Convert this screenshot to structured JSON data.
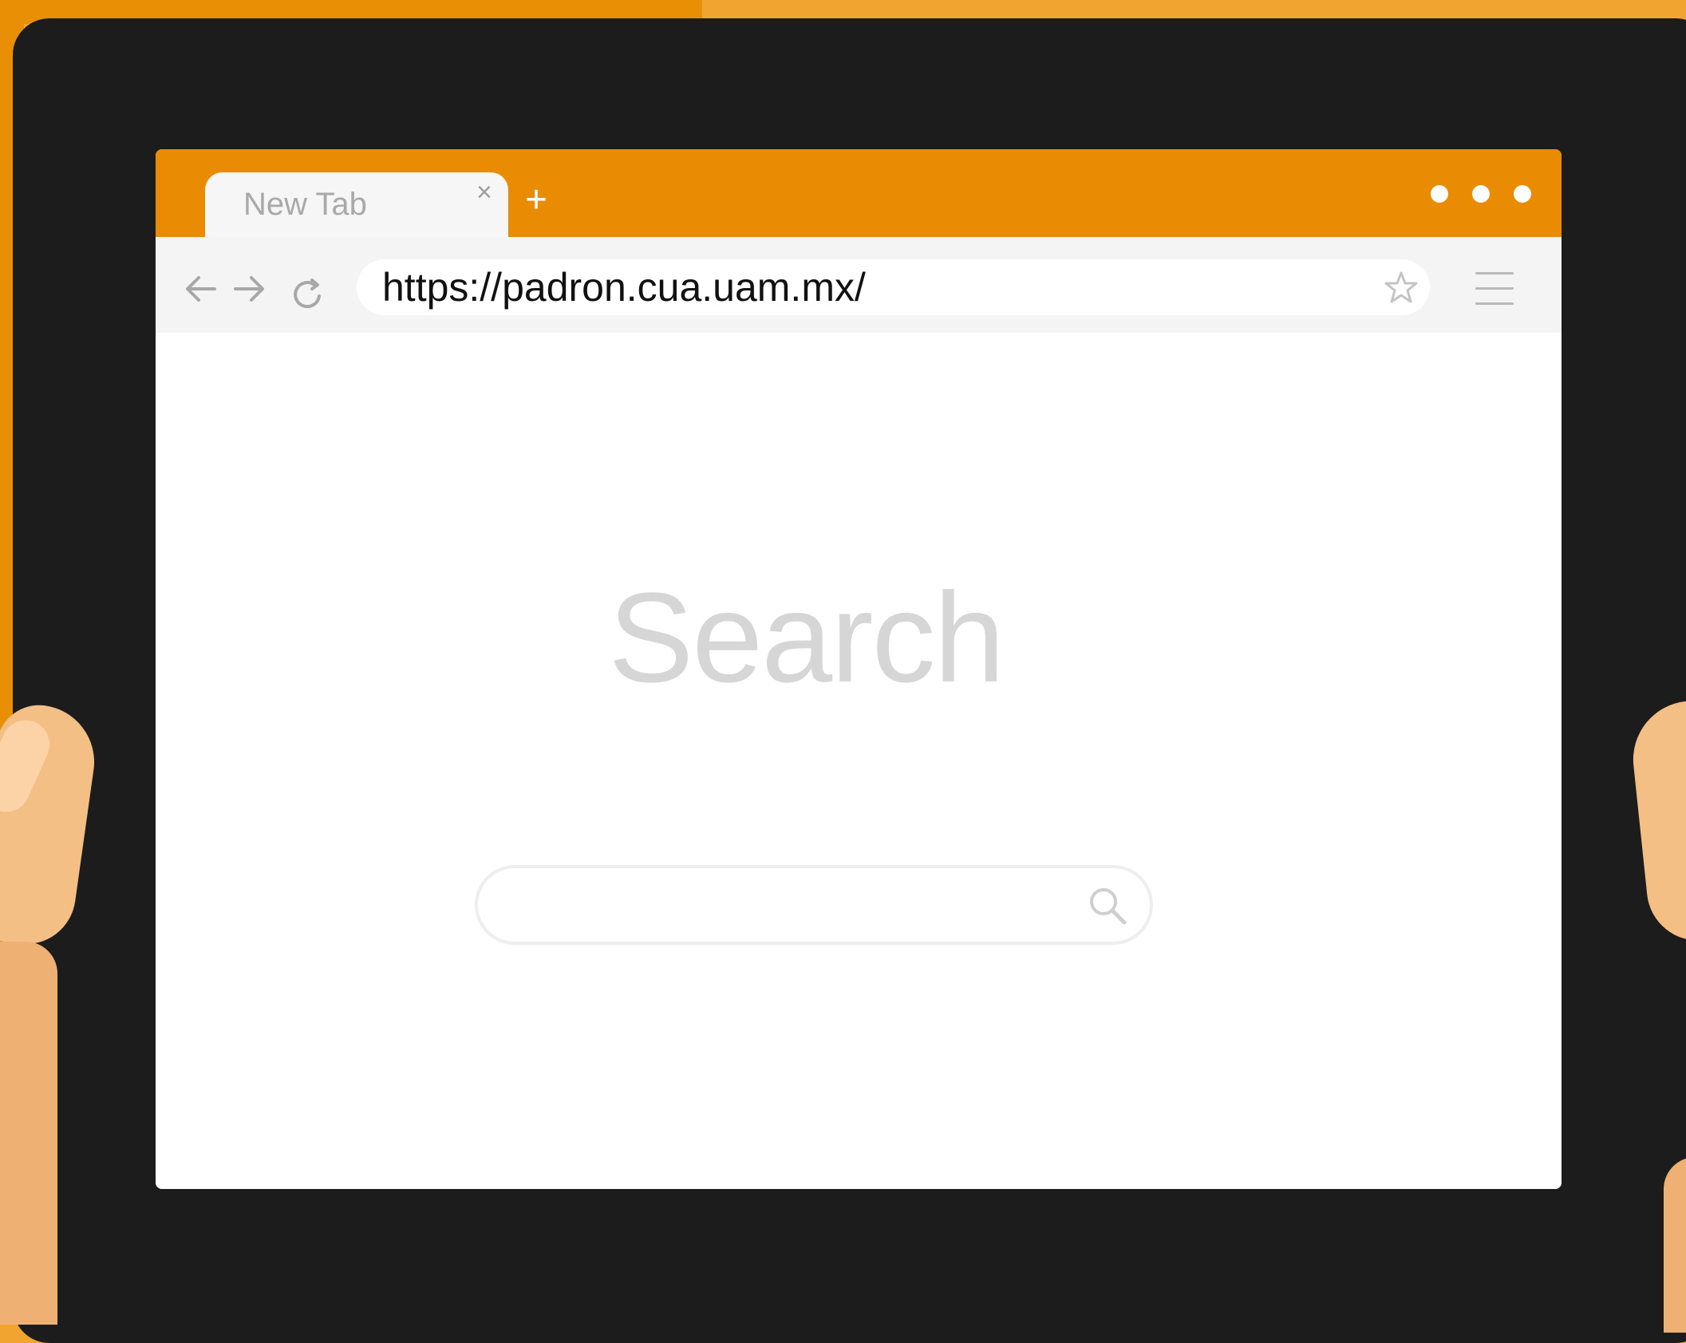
{
  "browser": {
    "tab": {
      "title": "New Tab",
      "close_glyph": "×"
    },
    "new_tab_glyph": "+",
    "address_bar": {
      "url": "https://padron.cua.uam.mx/"
    }
  },
  "page": {
    "search_heading": "Search",
    "search_input_value": ""
  },
  "icons": {
    "back": "arrow-left-icon",
    "forward": "arrow-right-icon",
    "reload": "reload-icon",
    "bookmark": "star-icon",
    "menu": "hamburger-menu-icon",
    "search": "magnifier-icon",
    "window_controls": "three-dots-icon"
  },
  "colors": {
    "background": "#f2a431",
    "tablet": "#1c1c1c",
    "tab_bar": "#ea8c03",
    "toolbar": "#f4f4f4",
    "heading": "#d6d6d6"
  }
}
